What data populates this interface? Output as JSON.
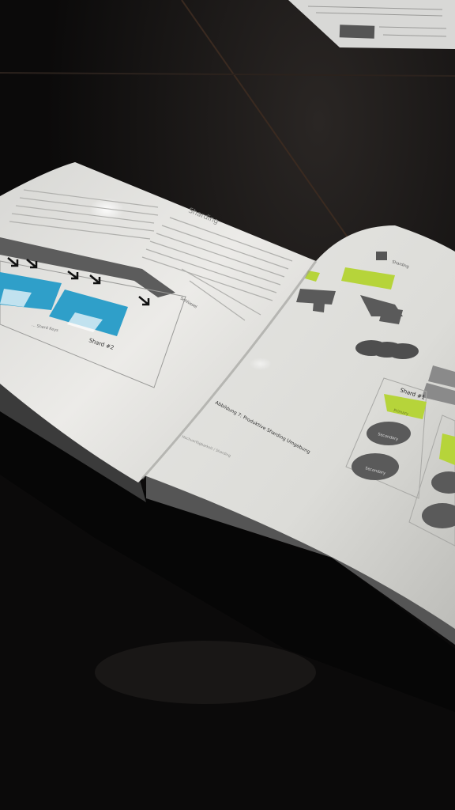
{
  "scene": {
    "description_tags": [
      "open-book",
      "dark-table",
      "sharding-diagrams"
    ]
  },
  "left_page": {
    "heading": "Sharding",
    "shard_label": "Shard #2",
    "caption": "... Shard Keys",
    "side_label": "Schlüssel"
  },
  "right_page": {
    "top_label": "Sharding",
    "figure_caption": "Abbildung 7: Produktive Sharding Umgebung",
    "shard_label": "Shard #1",
    "secondary_label_1": "Secondary",
    "secondary_label_2": "Secondary",
    "primary_label": "Primary",
    "footer": "Hochverfügbarkeit / Sharding"
  },
  "colors": {
    "table": "#0c0b0b",
    "page": "#e6e6e4",
    "accent_blue": "#2f9fc9",
    "accent_green": "#b6d43a",
    "gray_shape": "#5a5a5a"
  }
}
